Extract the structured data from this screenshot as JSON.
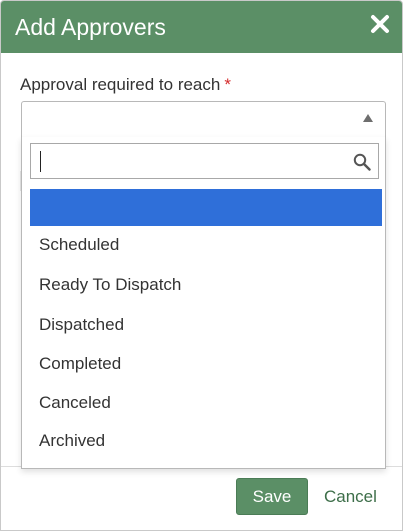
{
  "dialog": {
    "title": "Add Approvers",
    "close_icon": "close-icon",
    "header_color": "#5b8f66"
  },
  "field": {
    "label": "Approval required to reach",
    "required_marker": "*",
    "selected_value": ""
  },
  "dropdown": {
    "search_value": "",
    "search_icon": "search-icon",
    "highlight_color": "#2f6fd9",
    "highlighted_option": "",
    "options": [
      "Scheduled",
      "Ready To Dispatch",
      "Dispatched",
      "Completed",
      "Canceled",
      "Archived"
    ]
  },
  "footer": {
    "save_label": "Save",
    "cancel_label": "Cancel"
  }
}
